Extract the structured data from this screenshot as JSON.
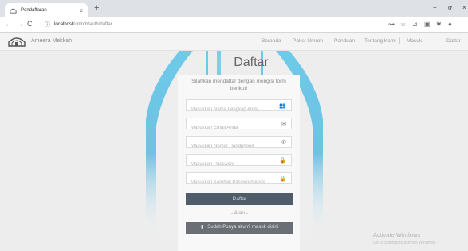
{
  "browser": {
    "tab_title": "Pendaftaran",
    "tab_close": "×",
    "new_tab": "+",
    "window_controls": [
      "−",
      "ơ",
      "×"
    ],
    "url_host": "localhost",
    "url_path": "/umroh/auth/daftar"
  },
  "navbar": {
    "brand": "Ameera Mekkah",
    "items": [
      "Beranda",
      "Paket Umroh",
      "Panduan",
      "Tentang Kami"
    ],
    "separator": "|",
    "right_items": [
      "Masuk",
      "Daftar"
    ]
  },
  "form": {
    "title": "Daftar",
    "intro": "Silahkan mendaftar dengan mengisi form berikut!",
    "fields": [
      {
        "placeholder": "Masukkan Nama Lengkap Anda",
        "icon": "users-icon",
        "glyph": "👥"
      },
      {
        "placeholder": "Masukkan Email Anda",
        "icon": "envelope-icon",
        "glyph": "✉"
      },
      {
        "placeholder": "Masukkan Nomor Handphone",
        "icon": "phone-icon",
        "glyph": "✆"
      },
      {
        "placeholder": "Masukkan Password",
        "icon": "lock-icon",
        "glyph": "🔒"
      },
      {
        "placeholder": "Masukkan Kembali Password Anda",
        "icon": "lock-icon",
        "glyph": "🔒"
      }
    ],
    "submit_label": "Daftar",
    "or_label": "- Atau -",
    "login_label": "Sudah Punya akun? masuk disini"
  },
  "windows_notice": {
    "title": "Activate Windows",
    "subtitle": "Go to Settings to activate Windows."
  }
}
